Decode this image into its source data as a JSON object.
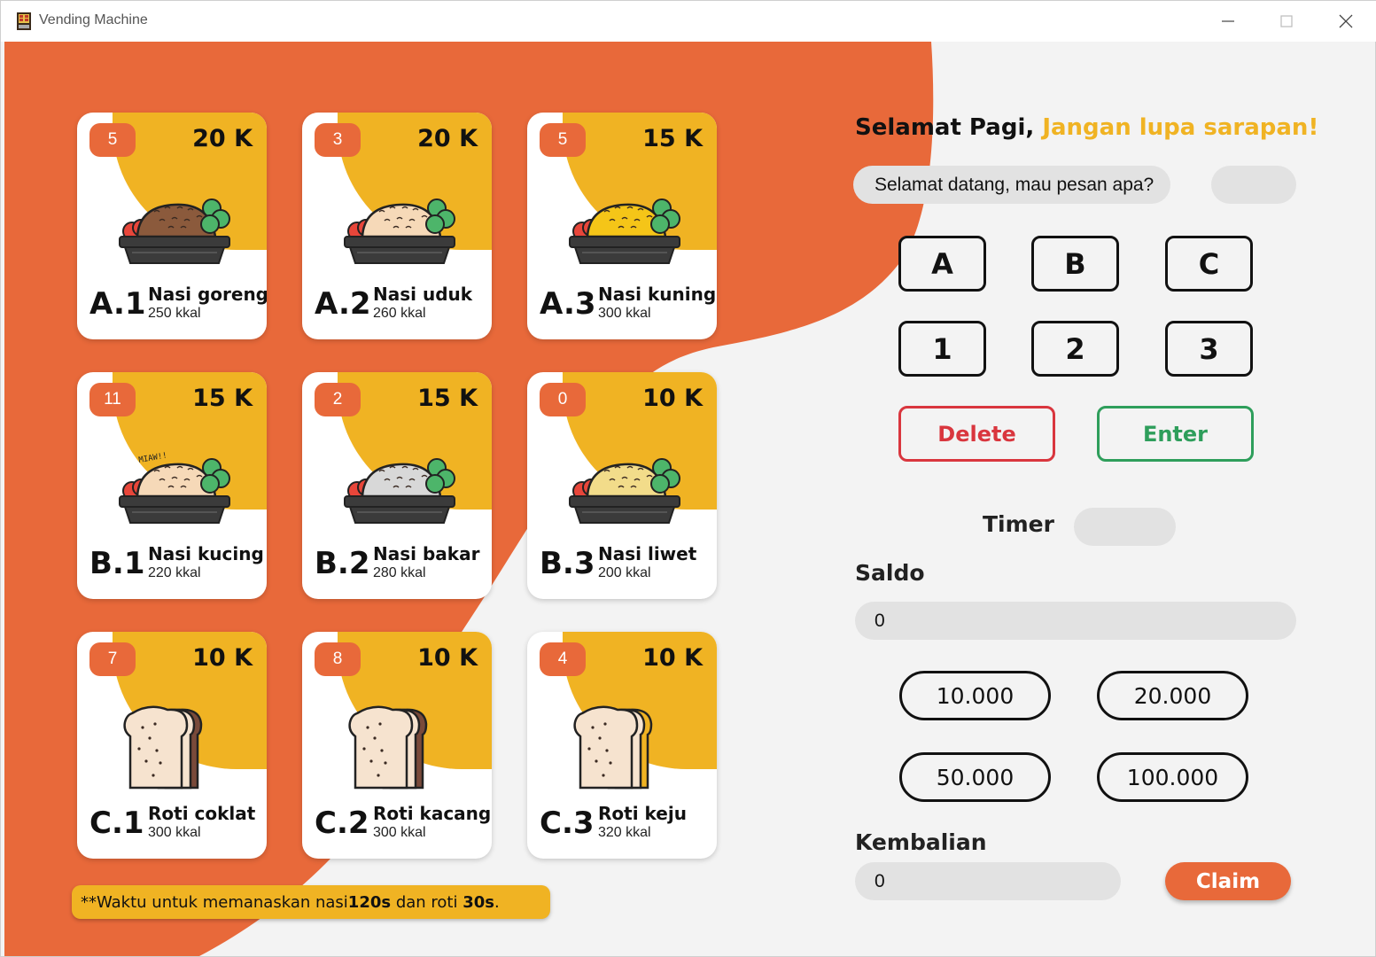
{
  "window": {
    "title": "Vending Machine"
  },
  "colors": {
    "orange": "#E8693A",
    "yellow": "#F0B323",
    "red": "#D9363E",
    "green": "#2E9E5B",
    "panel": "#f3f3f3"
  },
  "menu": [
    {
      "stock": "5",
      "price": "20 K",
      "code": "A.1",
      "name": "Nasi goreng",
      "kcal": "250 kkal",
      "food": "rice-brown",
      "rice": "#8B5A3C"
    },
    {
      "stock": "3",
      "price": "20 K",
      "code": "A.2",
      "name": "Nasi uduk",
      "kcal": "260 kkal",
      "food": "rice-cream",
      "rice": "#F6D9B8"
    },
    {
      "stock": "5",
      "price": "15 K",
      "code": "A.3",
      "name": "Nasi kuning",
      "kcal": "300 kkal",
      "food": "rice-yellow",
      "rice": "#F5C518"
    },
    {
      "stock": "11",
      "price": "15 K",
      "code": "B.1",
      "name": "Nasi kucing",
      "kcal": "220 kkal",
      "food": "rice-cat",
      "rice": "#F6D9B8",
      "doodle": "MIAW!!"
    },
    {
      "stock": "2",
      "price": "15 K",
      "code": "B.2",
      "name": "Nasi bakar",
      "kcal": "280 kkal",
      "food": "rice-grey",
      "rice": "#D8D8D8"
    },
    {
      "stock": "0",
      "price": "10 K",
      "code": "B.3",
      "name": "Nasi liwet",
      "kcal": "200 kkal",
      "food": "rice-liwet",
      "rice": "#F2DC8A"
    },
    {
      "stock": "7",
      "price": "10 K",
      "code": "C.1",
      "name": "Roti coklat",
      "kcal": "300 kkal",
      "food": "bread-chocolate",
      "filling": "#7A4A3A"
    },
    {
      "stock": "8",
      "price": "10 K",
      "code": "C.2",
      "name": "Roti kacang",
      "kcal": "300 kkal",
      "food": "bread-peanut",
      "filling": "#7A4A3A"
    },
    {
      "stock": "4",
      "price": "10 K",
      "code": "C.3",
      "name": "Roti keju",
      "kcal": "320 kkal",
      "food": "bread-cheese",
      "filling": "#F0B323"
    }
  ],
  "note": {
    "prefix": "**Waktu untuk memanaskan nasi ",
    "nasi_time": "120s",
    "middle": " dan roti ",
    "roti_time": "30s",
    "suffix": "."
  },
  "greeting": {
    "bold": "Selamat Pagi,",
    "accent": "Jangan lupa sarapan!"
  },
  "message": "Selamat datang, mau pesan apa?",
  "keypad": {
    "letters": [
      "A",
      "B",
      "C"
    ],
    "numbers": [
      "1",
      "2",
      "3"
    ],
    "delete": "Delete",
    "enter": "Enter"
  },
  "timer": {
    "label": "Timer",
    "value": ""
  },
  "saldo": {
    "label": "Saldo",
    "value": "0"
  },
  "money_buttons": [
    "10.000",
    "20.000",
    "50.000",
    "100.000"
  ],
  "kembalian": {
    "label": "Kembalian",
    "value": "0",
    "claim": "Claim"
  }
}
